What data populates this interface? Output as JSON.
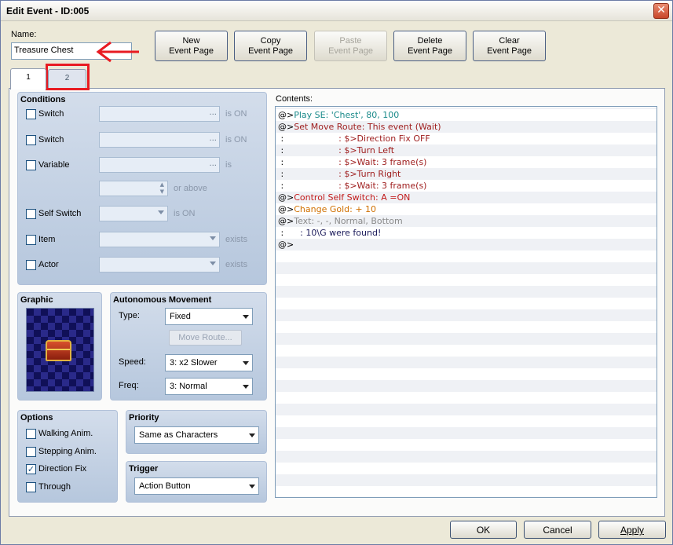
{
  "window": {
    "title": "Edit Event - ID:005",
    "close_glyph": "✕"
  },
  "name_label": "Name:",
  "name_value": "Treasure Chest",
  "toolbar": [
    {
      "line1": "New",
      "line2": "Event Page",
      "enabled": true
    },
    {
      "line1": "Copy",
      "line2": "Event Page",
      "enabled": true
    },
    {
      "line1": "Paste",
      "line2": "Event Page",
      "enabled": false
    },
    {
      "line1": "Delete",
      "line2": "Event Page",
      "enabled": true
    },
    {
      "line1": "Clear",
      "line2": "Event Page",
      "enabled": true
    }
  ],
  "tabs": [
    "1",
    "2"
  ],
  "conditions": {
    "title": "Conditions",
    "switch1": "Switch",
    "switch2": "Switch",
    "variable": "Variable",
    "self_switch": "Self Switch",
    "item": "Item",
    "actor": "Actor",
    "is_on": "is ON",
    "is": "is",
    "or_above": "or above",
    "exists": "exists",
    "ellipsis": "..."
  },
  "graphic": {
    "title": "Graphic",
    "icon": "treasure-chest-sprite"
  },
  "movement": {
    "title": "Autonomous Movement",
    "type_label": "Type:",
    "type_value": "Fixed",
    "move_route": "Move Route...",
    "speed_label": "Speed:",
    "speed_value": "3: x2 Slower",
    "freq_label": "Freq:",
    "freq_value": "3: Normal"
  },
  "options": {
    "title": "Options",
    "walking": "Walking Anim.",
    "stepping": "Stepping Anim.",
    "direction_fix": "Direction Fix",
    "through": "Through",
    "checkmark": "✓"
  },
  "priority": {
    "title": "Priority",
    "value": "Same as Characters"
  },
  "trigger": {
    "title": "Trigger",
    "value": "Action Button"
  },
  "contents": {
    "label": "Contents:",
    "lines": [
      {
        "prefix": "@>",
        "text": "Play SE: 'Chest', 80, 100",
        "color": "#1b8a8a"
      },
      {
        "prefix": "@>",
        "text": "Set Move Route: This event (Wait)",
        "color": "#9e1c1c"
      },
      {
        "prefix": " :",
        "text": "                    : $>Direction Fix OFF",
        "color": "#9e1c1c"
      },
      {
        "prefix": " :",
        "text": "                    : $>Turn Left",
        "color": "#9e1c1c"
      },
      {
        "prefix": " :",
        "text": "                    : $>Wait: 3 frame(s)",
        "color": "#9e1c1c"
      },
      {
        "prefix": " :",
        "text": "                    : $>Turn Right",
        "color": "#9e1c1c"
      },
      {
        "prefix": " :",
        "text": "                    : $>Wait: 3 frame(s)",
        "color": "#9e1c1c"
      },
      {
        "prefix": "@>",
        "text": "Control Self Switch: A =ON",
        "color": "#c21a1a"
      },
      {
        "prefix": "@>",
        "text": "Change Gold: + 10",
        "color": "#d07000"
      },
      {
        "prefix": "@>",
        "text": "Text: -, -, Normal, Bottom",
        "color": "#8b8b8b"
      },
      {
        "prefix": " :",
        "text": "      : 10\\G were found!",
        "color": "#1a1a5a"
      },
      {
        "prefix": "@>",
        "text": "",
        "color": "#000000"
      }
    ]
  },
  "footer": {
    "ok": "OK",
    "cancel": "Cancel",
    "apply": "Apply"
  },
  "annotations": {
    "highlight_color": "#e81b22"
  }
}
